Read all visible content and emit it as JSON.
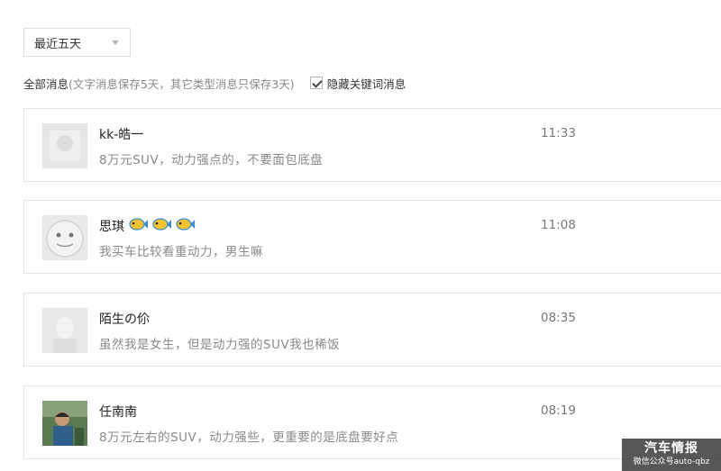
{
  "filter": {
    "range_select": "最近五天",
    "title": "全部消息",
    "note": "(文字消息保存5天，其它类型消息只保存3天)",
    "hide_keyword_label": "隐藏关键词消息",
    "hide_keyword_checked": true
  },
  "messages": [
    {
      "name": "kk-皓一",
      "text": "8万元SUV，动力强点的，不要面包底盘",
      "time": "11:33",
      "avatar_icon": "blurred-avatar-icon"
    },
    {
      "name": "思琪",
      "text": "我买车比较看重动力，男生嘛",
      "time": "11:08",
      "avatar_icon": "cartoon-face-avatar-icon",
      "emoji": [
        "fish-emoji",
        "fish-emoji",
        "fish-emoji"
      ]
    },
    {
      "name": "陌生の伱",
      "text": "虽然我是女生，但是动力强的SUV我也稀饭",
      "time": "08:35",
      "avatar_icon": "blurred-avatar-icon"
    },
    {
      "name": "任南南",
      "text": "8万元左右的SUV，动力强些，更重要的是底盘要好点",
      "time": "08:19",
      "avatar_icon": "photo-avatar-icon"
    }
  ],
  "watermark": {
    "title": "汽车情报",
    "subtitle": "微信公众号auto-qbz"
  }
}
